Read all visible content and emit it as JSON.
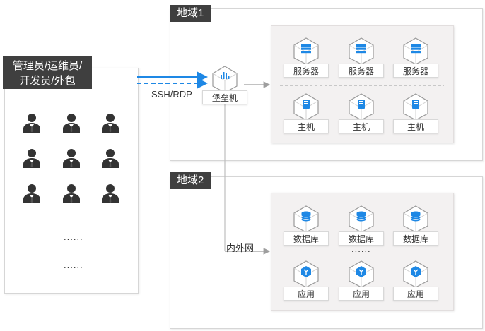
{
  "users": {
    "label_line1": "管理员/运维员/",
    "label_line2": "开发员/外包",
    "dots_1": "......",
    "dots_2": "......"
  },
  "protocol_label": "SSH/RDP",
  "bastion": {
    "label": "堡垒机",
    "icon": "bar-chart-icon"
  },
  "network_label": "内外网",
  "region1": {
    "label": "地域1",
    "servers": [
      "服务器",
      "服务器",
      "服务器"
    ],
    "hosts": [
      "主机",
      "主机",
      "主机"
    ]
  },
  "region2": {
    "label": "地域2",
    "databases": [
      "数据库",
      "数据库",
      "数据库"
    ],
    "db_dots": "......",
    "apps": [
      "应用",
      "应用",
      "应用"
    ]
  },
  "colors": {
    "accent": "#1e88e5",
    "dark": "#3f3f3f",
    "line": "#9e9e9e"
  },
  "icons": [
    "server-icon",
    "host-icon",
    "database-icon",
    "app-icon",
    "user-icon"
  ]
}
